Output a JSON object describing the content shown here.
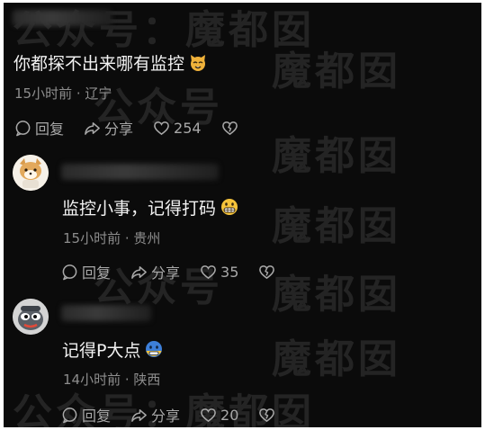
{
  "watermark": {
    "wm1": "公众号：魔都囡",
    "wm2": "魔都囡",
    "wm3": "公众号"
  },
  "comments": [
    {
      "text": "你都探不出来哪有监控",
      "emoji": "cat-face-icon",
      "meta": "15小时前 · 辽宁",
      "reply_label": "回复",
      "share_label": "分享",
      "likes": "254"
    },
    {
      "text": "监控小事，记得打码",
      "emoji": "grimacing-face-icon",
      "meta": "15小时前 · 贵州",
      "reply_label": "回复",
      "share_label": "分享",
      "likes": "35"
    },
    {
      "text": "记得P大点",
      "emoji": "cold-face-icon",
      "meta": "14小时前 · 陕西",
      "reply_label": "回复",
      "share_label": "分享",
      "likes": "20"
    }
  ],
  "colors": {
    "background": "#0b0b0b",
    "text": "#f2f2f2",
    "meta": "#8d8d8d",
    "action": "#a8a8a8"
  }
}
